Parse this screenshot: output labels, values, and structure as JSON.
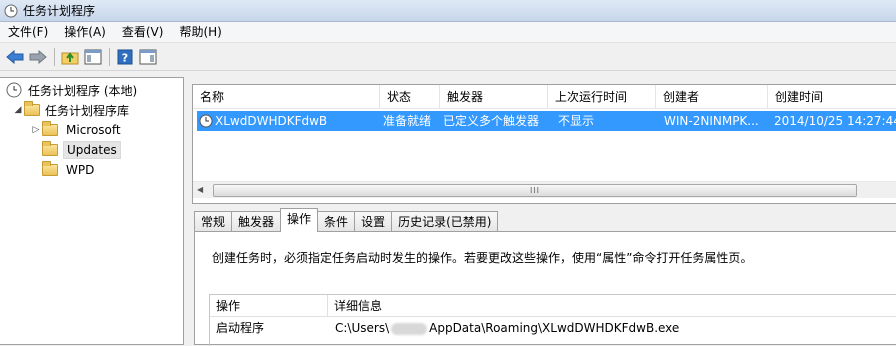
{
  "window": {
    "title": "任务计划程序"
  },
  "menu": {
    "items": [
      "文件(F)",
      "操作(A)",
      "查看(V)",
      "帮助(H)"
    ]
  },
  "tree": {
    "root": "任务计划程序 (本地)",
    "library": "任务计划程序库",
    "children": [
      "Microsoft",
      "Updates",
      "WPD"
    ],
    "selected": "Updates"
  },
  "task_list": {
    "columns": [
      "名称",
      "状态",
      "触发器",
      "上次运行时间",
      "创建者",
      "创建时间"
    ],
    "rows": [
      {
        "name": "XLwdDWHDKFdwB",
        "status": "准备就绪",
        "trigger": "已定义多个触发器",
        "last_run": "不显示",
        "author": "WIN-2NINMPK...",
        "created": "2014/10/25 14:27:44"
      }
    ],
    "scroll_glyph": "III"
  },
  "detail_tabs": {
    "items": [
      "常规",
      "触发器",
      "操作",
      "条件",
      "设置",
      "历史记录(已禁用)"
    ],
    "active": "操作"
  },
  "actions_pane": {
    "description": "创建任务时，必须指定任务启动时发生的操作。若要更改这些操作，使用“属性”命令打开任务属性页。",
    "columns": [
      "操作",
      "详细信息"
    ],
    "rows": [
      {
        "action": "启动程序",
        "detail_prefix": "C:\\Users\\",
        "detail_suffix": "AppData\\Roaming\\XLwdDWHDKFdwB.exe"
      }
    ]
  },
  "colors": {
    "selection": "#3399ff",
    "title_bar": "#c7d6ea"
  }
}
